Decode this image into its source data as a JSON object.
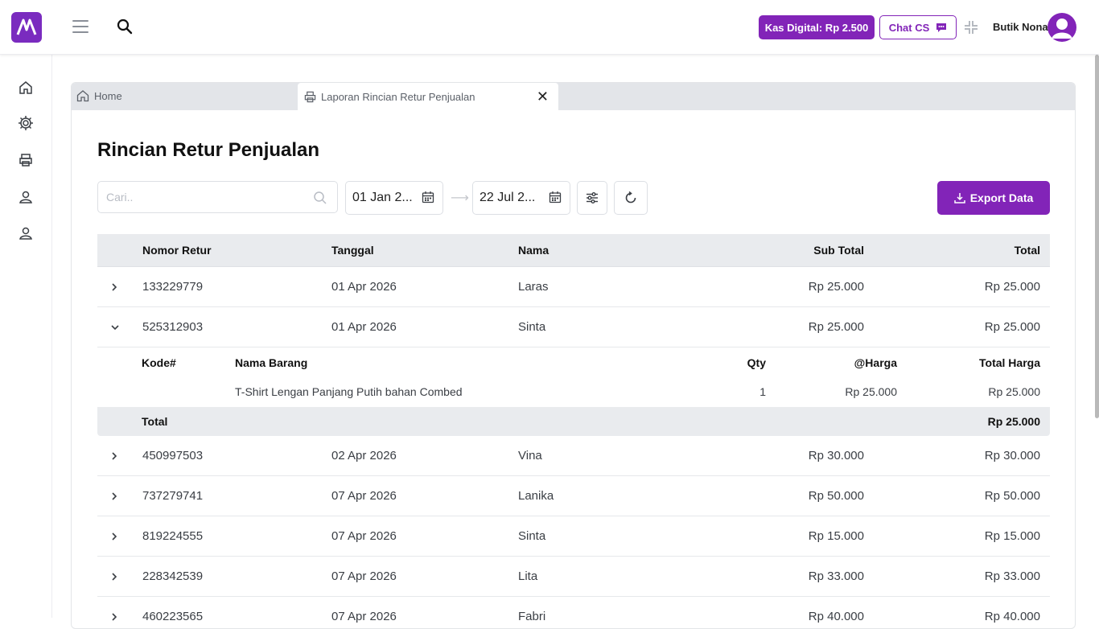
{
  "header": {
    "kas_label": "Kas Digital: Rp 2.500",
    "chat_label": "Chat CS",
    "user_name": "Butik Nona"
  },
  "tabs": {
    "home": "Home",
    "active": "Laporan Rincian Retur Penjualan"
  },
  "page": {
    "title": "Rincian Retur Penjualan",
    "search_placeholder": "Cari..",
    "date_from": "01 Jan 2...",
    "date_to": "22 Jul 2...",
    "export_label": "Export Data"
  },
  "table": {
    "headers": [
      "Nomor Retur",
      "Tanggal",
      "Nama",
      "Sub Total",
      "Total"
    ],
    "rows": [
      {
        "nomor": "133229779",
        "tanggal": "01 Apr 2026",
        "nama": "Laras",
        "sub": "Rp 25.000",
        "total": "Rp 25.000",
        "expanded": false
      },
      {
        "nomor": "525312903",
        "tanggal": "01 Apr 2026",
        "nama": "Sinta",
        "sub": "Rp 25.000",
        "total": "Rp 25.000",
        "expanded": true
      },
      {
        "nomor": "450997503",
        "tanggal": "02 Apr 2026",
        "nama": "Vina",
        "sub": "Rp 30.000",
        "total": "Rp 30.000",
        "expanded": false
      },
      {
        "nomor": "737279741",
        "tanggal": "07 Apr 2026",
        "nama": "Lanika",
        "sub": "Rp 50.000",
        "total": "Rp 50.000",
        "expanded": false
      },
      {
        "nomor": "819224555",
        "tanggal": "07 Apr 2026",
        "nama": "Sinta",
        "sub": "Rp 15.000",
        "total": "Rp 15.000",
        "expanded": false
      },
      {
        "nomor": "228342539",
        "tanggal": "07 Apr 2026",
        "nama": "Lita",
        "sub": "Rp 33.000",
        "total": "Rp 33.000",
        "expanded": false
      },
      {
        "nomor": "460223565",
        "tanggal": "07 Apr 2026",
        "nama": "Fabri",
        "sub": "Rp 40.000",
        "total": "Rp 40.000",
        "expanded": false
      }
    ]
  },
  "detail": {
    "headers": [
      "Kode#",
      "Nama Barang",
      "Qty",
      "@Harga",
      "Total Harga"
    ],
    "item": {
      "kode": "",
      "nama": "T-Shirt Lengan Panjang Putih bahan Combed",
      "qty": "1",
      "harga": "Rp 25.000",
      "total": "Rp 25.000"
    },
    "total_label": "Total",
    "total_value": "Rp 25.000"
  },
  "colors": {
    "accent": "#8224b8",
    "header_bg": "#e9ebee"
  }
}
